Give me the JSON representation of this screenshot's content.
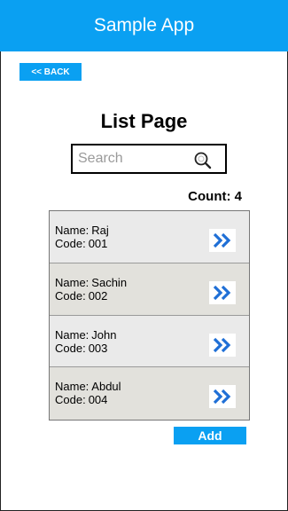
{
  "header": {
    "title": "Sample App"
  },
  "nav": {
    "back_label": "<< BACK"
  },
  "page": {
    "title": "List Page"
  },
  "search": {
    "placeholder": "Search",
    "value": "",
    "icon": "magnifier-icon"
  },
  "count": {
    "label": "Count:",
    "value": "4",
    "text": "Count: 4"
  },
  "list": {
    "name_label": "Name:",
    "code_label": "Code:",
    "row_action_icon": "double-chevron-right-icon",
    "items": [
      {
        "name": "Raj",
        "code": "001"
      },
      {
        "name": "Sachin",
        "code": "002"
      },
      {
        "name": "John",
        "code": "003"
      },
      {
        "name": "Abdul",
        "code": "004"
      }
    ]
  },
  "actions": {
    "add_label": "Add"
  },
  "colors": {
    "accent": "#0aa0f2",
    "row_light": "#eaeaea",
    "row_dark": "#e2e1dc",
    "chevron": "#1f6fd6"
  }
}
